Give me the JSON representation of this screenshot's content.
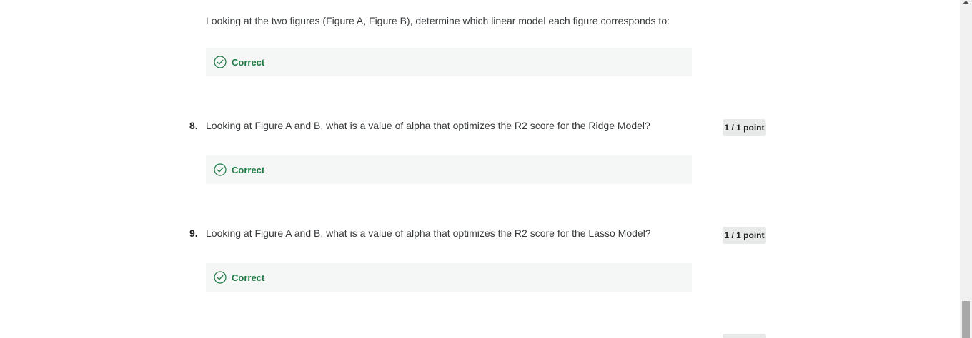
{
  "questions": [
    {
      "number": "",
      "text": "Looking at the two figures (Figure A, Figure B), determine which linear model each figure corresponds to:",
      "feedback": "Correct",
      "points": ""
    },
    {
      "number": "8.",
      "text": "Looking at Figure A and B, what is a value of alpha that optimizes the R2 score for the Ridge Model?",
      "feedback": "Correct",
      "points": "1 / 1 point"
    },
    {
      "number": "9.",
      "text": "Looking at Figure A and B, what is a value of alpha that optimizes the R2 score for the Lasso Model?",
      "feedback": "Correct",
      "points": "1 / 1 point"
    }
  ],
  "colors": {
    "correct": "#1f7a44",
    "feedback_bg": "#f5f7f7",
    "points_bg": "#e8eaea"
  },
  "icons": {
    "feedback": "check-circle-icon",
    "scroll_up": "chevron-up-icon"
  }
}
